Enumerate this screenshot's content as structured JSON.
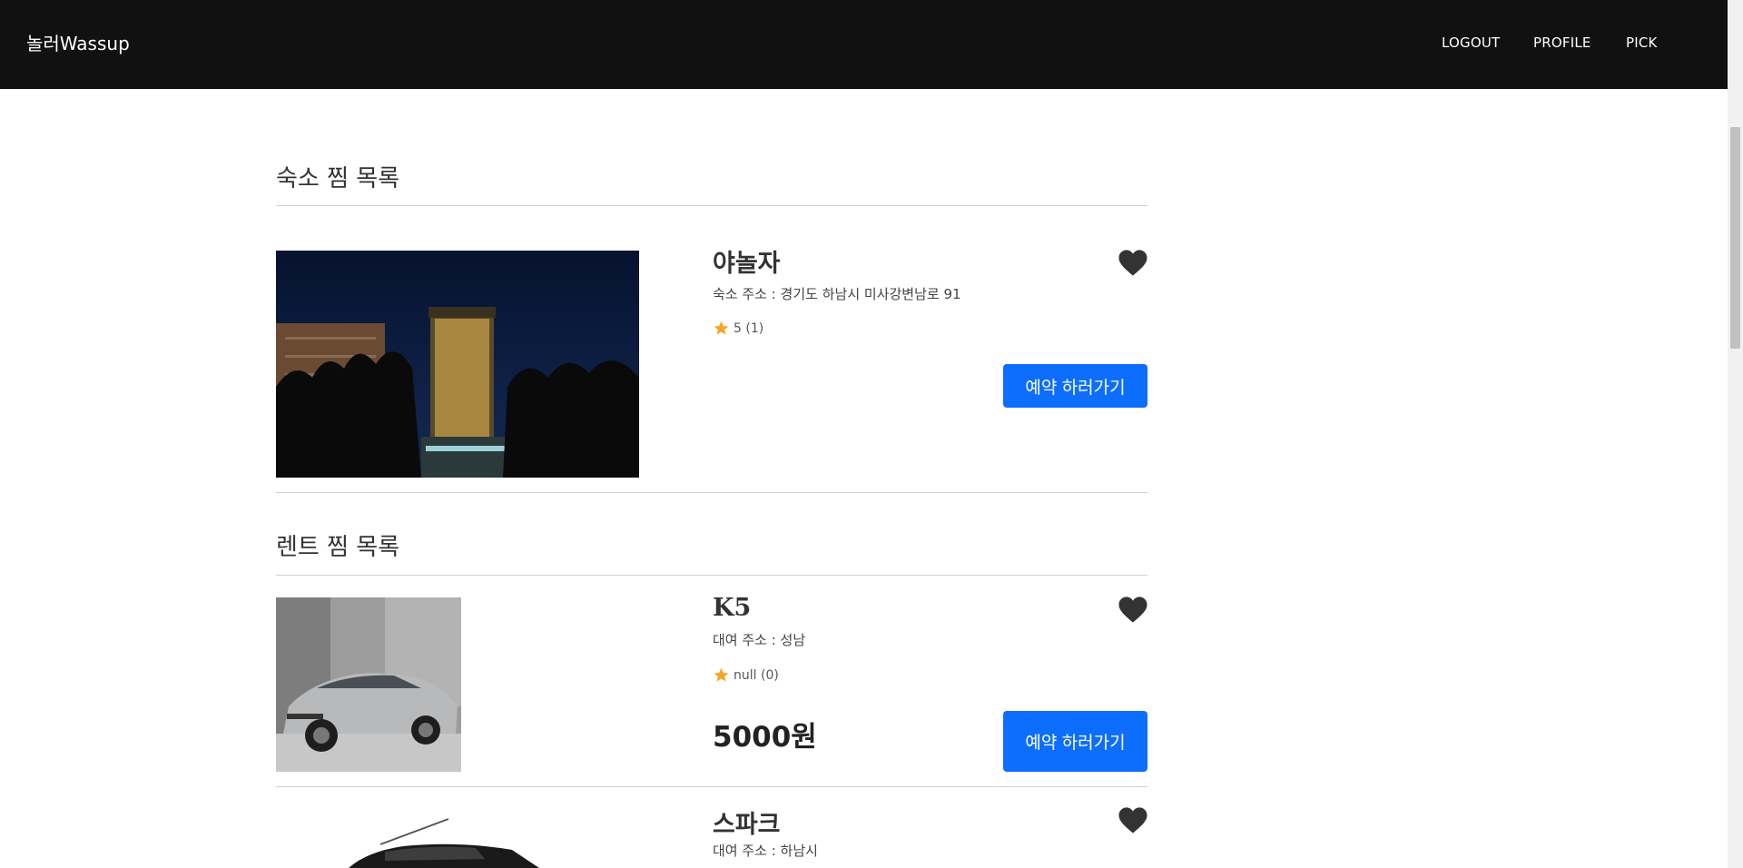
{
  "navbar": {
    "brand": "놀러Wassup",
    "links": [
      "LOGOUT",
      "PROFILE",
      "PICK"
    ]
  },
  "sections": {
    "lodging": {
      "title": "숙소 찜 목록",
      "items": [
        {
          "name": "야놀자",
          "address": "숙소 주소 : 경기도 하남시 미사강변남로 91",
          "rating": "5 (1)",
          "button": "예약 하러가기"
        }
      ]
    },
    "rent": {
      "title": "렌트 찜 목록",
      "items": [
        {
          "name": "K5",
          "address": "대여 주소 : 성남",
          "rating": "null (0)",
          "price": "5000원",
          "button": "예약 하러가기"
        },
        {
          "name": "스파크",
          "address": "대여 주소 : 하남시"
        }
      ]
    }
  },
  "colors": {
    "accent": "#0d6efd",
    "navbar": "#111111",
    "star": "#f5a623",
    "heart": "#333333"
  }
}
